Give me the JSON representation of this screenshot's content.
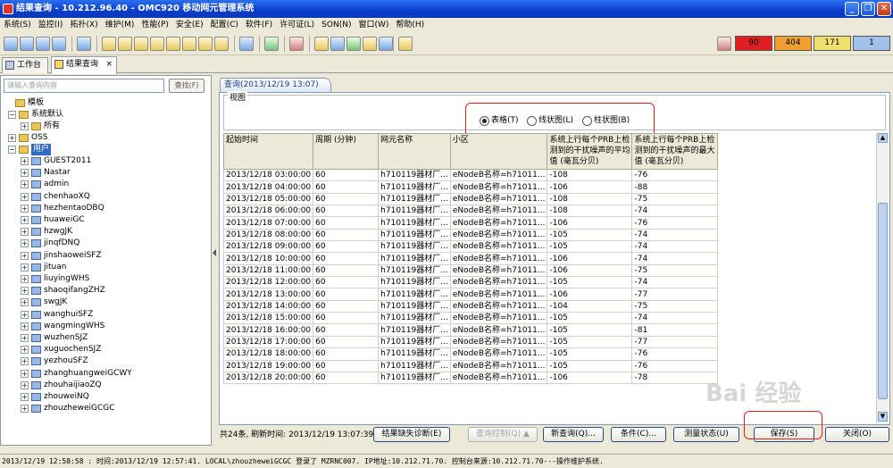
{
  "window": {
    "title": "结果查询 - 10.212.96.40 - OMC920 移动网元管理系统"
  },
  "menu": [
    "系统(S)",
    "监控(I)",
    "拓扑(X)",
    "维护(M)",
    "性能(P)",
    "安全(E)",
    "配置(C)",
    "软件(F)",
    "许可证(L)",
    "SON(N)",
    "窗口(W)",
    "帮助(H)"
  ],
  "alarms": [
    {
      "value": "90",
      "color": "#e02020"
    },
    {
      "value": "404",
      "color": "#f0a030"
    },
    {
      "value": "171",
      "color": "#f0e070"
    },
    {
      "value": "1",
      "color": "#a0c0e8"
    }
  ],
  "tabs": [
    {
      "label": "工作台"
    },
    {
      "label": "结果查询"
    }
  ],
  "tab_close": "×",
  "left": {
    "search_placeholder": "请输入查询内容",
    "search_button": "查找(F)",
    "tree": {
      "root": "模板",
      "sys": "系统默认",
      "all": "所有",
      "oss": "OSS",
      "user": "用户",
      "users": [
        "GUEST2011",
        "Nastar",
        "admin",
        "chenhaoXQ",
        "hezhentaoDBQ",
        "huaweiGC",
        "hzwgJK",
        "jinqfDNQ",
        "jinshaoweiSFZ",
        "jituan",
        "liuyingWHS",
        "shaoqifangZHZ",
        "swgJK",
        "wanghuiSFZ",
        "wangmingWHS",
        "wuzhenSJZ",
        "xuguochenSJZ",
        "yezhouSFZ",
        "zhanghuangweiGCWY",
        "zhouhaijiaoZQ",
        "zhouweiNQ",
        "zhouzheweiGCGC"
      ]
    }
  },
  "query": {
    "tab_label": "查询(2013/12/19 13:07)",
    "view_label": "视图",
    "views": [
      "表格(T)",
      "线状图(L)",
      "柱状图(B)"
    ],
    "columns": [
      "起始时间",
      "周期 (分钟)",
      "网元名称",
      "小区",
      "系统上行每个PRB上检测到的干扰噪声的平均值 (毫瓦分贝)",
      "系统上行每个PRB上检测到的干扰噪声的最大值 (毫瓦分贝)"
    ],
    "rows": [
      [
        "2013/12/18 03:00:00",
        "60",
        "h710119器材厂...",
        "eNodeB名称=h71011...",
        "-108",
        "-76"
      ],
      [
        "2013/12/18 04:00:00",
        "60",
        "h710119器材厂...",
        "eNodeB名称=h71011...",
        "-106",
        "-88"
      ],
      [
        "2013/12/18 05:00:00",
        "60",
        "h710119器材厂...",
        "eNodeB名称=h71011...",
        "-108",
        "-75"
      ],
      [
        "2013/12/18 06:00:00",
        "60",
        "h710119器材厂...",
        "eNodeB名称=h71011...",
        "-108",
        "-74"
      ],
      [
        "2013/12/18 07:00:00",
        "60",
        "h710119器材厂...",
        "eNodeB名称=h71011...",
        "-106",
        "-76"
      ],
      [
        "2013/12/18 08:00:00",
        "60",
        "h710119器材厂...",
        "eNodeB名称=h71011...",
        "-105",
        "-74"
      ],
      [
        "2013/12/18 09:00:00",
        "60",
        "h710119器材厂...",
        "eNodeB名称=h71011...",
        "-105",
        "-74"
      ],
      [
        "2013/12/18 10:00:00",
        "60",
        "h710119器材厂...",
        "eNodeB名称=h71011...",
        "-106",
        "-74"
      ],
      [
        "2013/12/18 11:00:00",
        "60",
        "h710119器材厂...",
        "eNodeB名称=h71011...",
        "-106",
        "-75"
      ],
      [
        "2013/12/18 12:00:00",
        "60",
        "h710119器材厂...",
        "eNodeB名称=h71011...",
        "-105",
        "-74"
      ],
      [
        "2013/12/18 13:00:00",
        "60",
        "h710119器材厂...",
        "eNodeB名称=h71011...",
        "-106",
        "-77"
      ],
      [
        "2013/12/18 14:00:00",
        "60",
        "h710119器材厂...",
        "eNodeB名称=h71011...",
        "-104",
        "-75"
      ],
      [
        "2013/12/18 15:00:00",
        "60",
        "h710119器材厂...",
        "eNodeB名称=h71011...",
        "-105",
        "-74"
      ],
      [
        "2013/12/18 16:00:00",
        "60",
        "h710119器材厂...",
        "eNodeB名称=h71011...",
        "-105",
        "-81"
      ],
      [
        "2013/12/18 17:00:00",
        "60",
        "h710119器材厂...",
        "eNodeB名称=h71011...",
        "-105",
        "-77"
      ],
      [
        "2013/12/18 18:00:00",
        "60",
        "h710119器材厂...",
        "eNodeB名称=h71011...",
        "-105",
        "-76"
      ],
      [
        "2013/12/18 19:00:00",
        "60",
        "h710119器材厂...",
        "eNodeB名称=h71011...",
        "-105",
        "-76"
      ],
      [
        "2013/12/18 20:00:00",
        "60",
        "h710119器材厂...",
        "eNodeB名称=h71011...",
        "-106",
        "-78"
      ]
    ],
    "status": "共24条, 刷新时间: 2013/12/19 13:07:39",
    "buttons": {
      "diag": "结果缺失诊断(E)",
      "ctrl": "查询控制(Q) ▲",
      "newq": "新查询(Q)...",
      "cond": "条件(C)...",
      "meas": "测量状态(U)",
      "save": "保存(S)",
      "close": "关闭(O)"
    }
  },
  "statusbar": "2013/12/19 12:58:58 : 时间:2013/12/19 12:57:41. LOCAL\\zhouzheweiGCGC 登录了 MZRNC007. IP地址:10.212.71.70. 控制台来源:10.212.71.70---操作维护系统.",
  "watermark": "Bai 经验"
}
